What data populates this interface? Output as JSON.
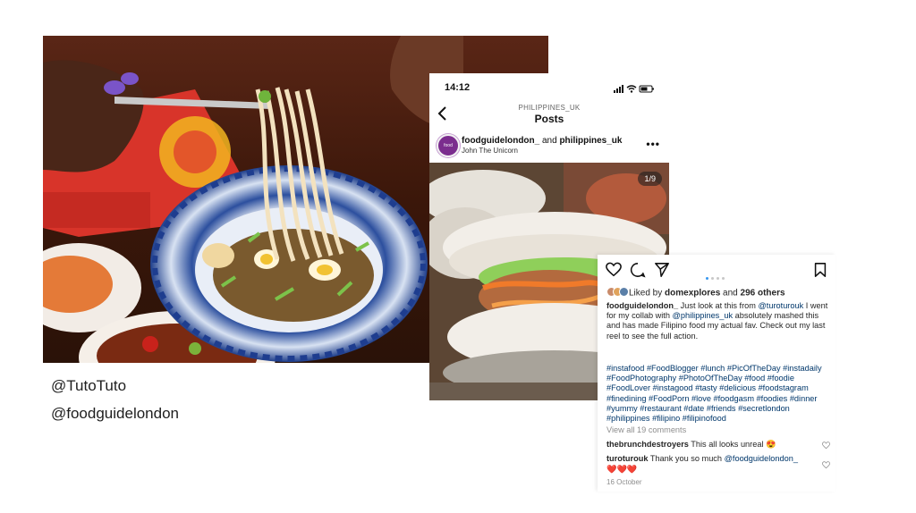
{
  "captions": {
    "credit_1": "@TutoTuto",
    "credit_2": "@foodguidelondon"
  },
  "phone": {
    "status_time": "14:12",
    "nav_account": "PHILIPPINES_UK",
    "nav_title": "Posts",
    "post_user_1": "foodguidelondon_",
    "post_user_join": " and ",
    "post_user_2": "philippines_uk",
    "post_subtitle": "John The Unicorn",
    "avatar_text": "food guide london",
    "image_counter": "1/9",
    "more_icon": "more-horizontal-icon"
  },
  "post": {
    "likes_prefix": "Liked by ",
    "likes_user": "domexplores",
    "likes_middle": " and ",
    "likes_count": "296 others",
    "caption_user": "foodguidelondon_",
    "caption_part1": " Just look at this from ",
    "caption_mention1": "@turoturouk",
    "caption_part2": " I went for my collab with ",
    "caption_mention2": "@philippines_uk",
    "caption_part3": " absolutely mashed this and has made Filipino food my actual fav. Check out my last reel to see the full action.",
    "hashtags": "#instafood #FoodBlogger #lunch #PicOfTheDay #instadaily #FoodPhotography #PhotoOfTheDay #food #foodie #FoodLover #instagood #tasty #delicious #foodstagram #finedining #FoodPorn #love #foodgasm #foodies #dinner #yummy #restaurant #date #friends #secretlondon #philippines #filipino #filipinofood",
    "view_all": "View all 19 comments",
    "comments": [
      {
        "user": "thebrunchdestroyers",
        "text": " This all looks unreal 😍"
      },
      {
        "user": "turoturouk",
        "text": " Thank you so much ",
        "mention": "@foodguidelondon_",
        "text2": " ❤️❤️❤️"
      }
    ],
    "date": "16 October"
  },
  "colors": {
    "link": "#00376b",
    "carousel_active": "#3897f0",
    "muted": "#8e8e8e"
  }
}
